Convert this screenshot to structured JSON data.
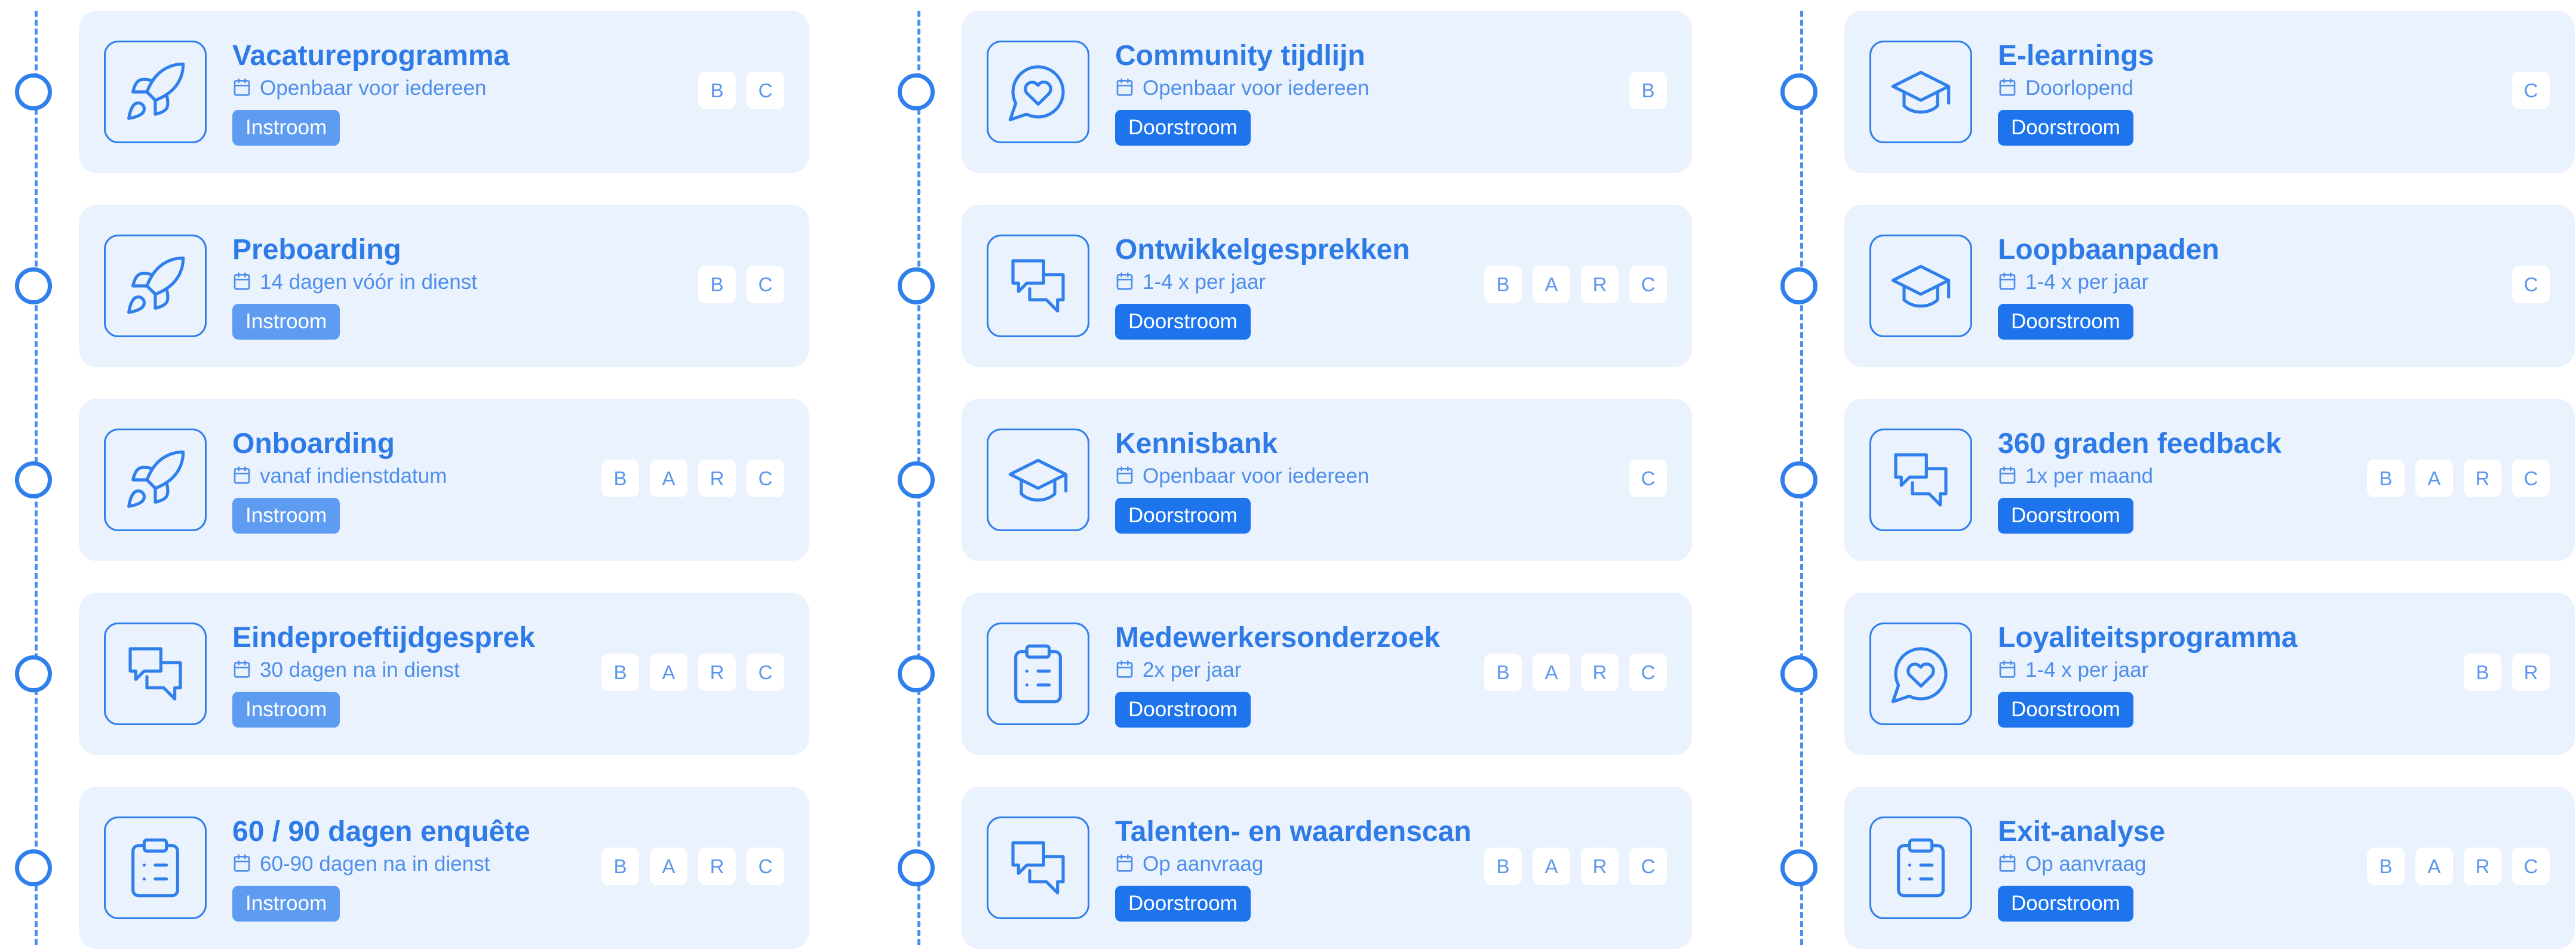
{
  "columns": [
    {
      "cards": [
        {
          "title": "Vacatureprogramma",
          "meta": "Openbaar voor iedereen",
          "badge": "Instroom",
          "badge_kind": "instroom",
          "icon": "rocket-icon",
          "tags": [
            "B",
            "C"
          ]
        },
        {
          "title": "Preboarding",
          "meta": "14 dagen vóór in dienst",
          "badge": "Instroom",
          "badge_kind": "instroom",
          "icon": "rocket-icon",
          "tags": [
            "B",
            "C"
          ]
        },
        {
          "title": "Onboarding",
          "meta": "vanaf indienstdatum",
          "badge": "Instroom",
          "badge_kind": "instroom",
          "icon": "rocket-icon",
          "tags": [
            "B",
            "A",
            "R",
            "C"
          ]
        },
        {
          "title": "Eindeproeftijdgesprek",
          "meta": "30 dagen na in dienst",
          "badge": "Instroom",
          "badge_kind": "instroom",
          "icon": "chat-bubbles-icon",
          "tags": [
            "B",
            "A",
            "R",
            "C"
          ]
        },
        {
          "title": "60 / 90 dagen enquête",
          "meta": "60-90 dagen na in dienst",
          "badge": "Instroom",
          "badge_kind": "instroom",
          "icon": "clipboard-icon",
          "tags": [
            "B",
            "A",
            "R",
            "C"
          ]
        }
      ]
    },
    {
      "cards": [
        {
          "title": "Community tijdlijn",
          "meta": "Openbaar voor iedereen",
          "badge": "Doorstroom",
          "badge_kind": "doorstroom",
          "icon": "heart-chat-icon",
          "tags": [
            "B"
          ]
        },
        {
          "title": "Ontwikkelgesprekken",
          "meta": "1-4 x per jaar",
          "badge": "Doorstroom",
          "badge_kind": "doorstroom",
          "icon": "chat-bubbles-icon",
          "tags": [
            "B",
            "A",
            "R",
            "C"
          ]
        },
        {
          "title": "Kennisbank",
          "meta": "Openbaar voor iedereen",
          "badge": "Doorstroom",
          "badge_kind": "doorstroom",
          "icon": "graduation-cap-icon",
          "tags": [
            "C"
          ]
        },
        {
          "title": "Medewerkersonderzoek",
          "meta": "2x per jaar",
          "badge": "Doorstroom",
          "badge_kind": "doorstroom",
          "icon": "clipboard-icon",
          "tags": [
            "B",
            "A",
            "R",
            "C"
          ]
        },
        {
          "title": "Talenten- en waardenscan",
          "meta": "Op aanvraag",
          "badge": "Doorstroom",
          "badge_kind": "doorstroom",
          "icon": "chat-bubbles-icon",
          "tags": [
            "B",
            "A",
            "R",
            "C"
          ]
        }
      ]
    },
    {
      "cards": [
        {
          "title": "E-learnings",
          "meta": "Doorlopend",
          "badge": "Doorstroom",
          "badge_kind": "doorstroom",
          "icon": "graduation-cap-icon",
          "tags": [
            "C"
          ]
        },
        {
          "title": "Loopbaanpaden",
          "meta": "1-4 x per jaar",
          "badge": "Doorstroom",
          "badge_kind": "doorstroom",
          "icon": "graduation-cap-icon",
          "tags": [
            "C"
          ]
        },
        {
          "title": "360 graden feedback",
          "meta": "1x per maand",
          "badge": "Doorstroom",
          "badge_kind": "doorstroom",
          "icon": "chat-bubbles-icon",
          "tags": [
            "B",
            "A",
            "R",
            "C"
          ]
        },
        {
          "title": "Loyaliteitsprogramma",
          "meta": "1-4 x per jaar",
          "badge": "Doorstroom",
          "badge_kind": "doorstroom",
          "icon": "heart-chat-icon",
          "tags": [
            "B",
            "R"
          ]
        },
        {
          "title": "Exit-analyse",
          "meta": "Op aanvraag",
          "badge": "Doorstroom",
          "badge_kind": "doorstroom",
          "icon": "clipboard-icon",
          "tags": [
            "B",
            "A",
            "R",
            "C"
          ]
        }
      ]
    }
  ],
  "colors": {
    "accent": "#2f7fec",
    "card_background": "#eaf2fd",
    "instroom_badge": "#5e9cf2",
    "doorstroom_badge": "#1d74ec"
  }
}
